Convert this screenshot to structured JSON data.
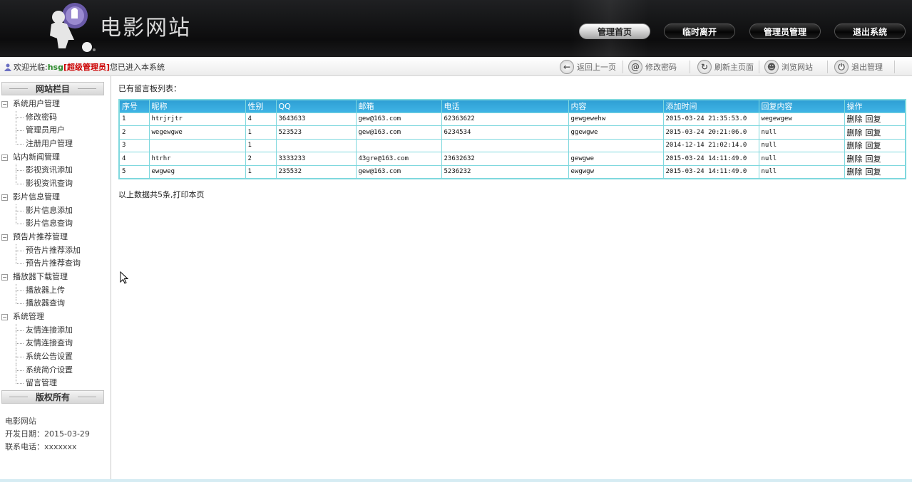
{
  "header": {
    "site_title": "电影网站",
    "nav": [
      {
        "label": "管理首页",
        "active": true
      },
      {
        "label": "临时离开",
        "active": false
      },
      {
        "label": "管理员管理",
        "active": false
      },
      {
        "label": "退出系统",
        "active": false
      }
    ]
  },
  "toolbar": {
    "welcome_prefix": "欢迎光临:",
    "username": "hsg",
    "role": "[超级管理员]",
    "welcome_suffix": "您已进入本系统",
    "buttons": [
      {
        "label": "返回上一页",
        "icon": "back-arrow-icon"
      },
      {
        "label": "修改密码",
        "icon": "swirl-icon"
      },
      {
        "label": "刷新主页面",
        "icon": "refresh-icon"
      },
      {
        "label": "浏览网站",
        "icon": "browse-icon"
      },
      {
        "label": "退出管理",
        "icon": "power-icon"
      }
    ]
  },
  "sidebar": {
    "section_title": "网站栏目",
    "groups": [
      {
        "label": "系统用户管理",
        "items": [
          "修改密码",
          "管理员用户",
          "注册用户管理"
        ]
      },
      {
        "label": "站内新闻管理",
        "items": [
          "影视资讯添加",
          "影视资讯查询"
        ]
      },
      {
        "label": "影片信息管理",
        "items": [
          "影片信息添加",
          "影片信息查询"
        ]
      },
      {
        "label": "预告片推荐管理",
        "items": [
          "预告片推荐添加",
          "预告片推荐查询"
        ]
      },
      {
        "label": "播放器下载管理",
        "items": [
          "播放器上传",
          "播放器查询"
        ]
      },
      {
        "label": "系统管理",
        "items": [
          "友情连接添加",
          "友情连接查询",
          "系统公告设置",
          "系统简介设置",
          "留言管理"
        ]
      }
    ],
    "copyright_title": "版权所有",
    "copyright_lines": [
      "电影网站",
      "开发日期：2015-03-29",
      "联系电话：xxxxxxx"
    ]
  },
  "main": {
    "list_title": "已有留言板列表：",
    "columns": [
      "序号",
      "昵称",
      "性别",
      "QQ",
      "邮箱",
      "电话",
      "内容",
      "添加时间",
      "回复内容",
      "操作"
    ],
    "rows": [
      [
        "1",
        "htrjrjtr",
        "4",
        "3643633",
        "gew@163.com",
        "62363622",
        "gewgewehw",
        "2015-03-24 21:35:53.0",
        "wegewgew"
      ],
      [
        "2",
        "wegewgwe",
        "1",
        "523523",
        "gew@163.com",
        "6234534",
        "ggewgwe",
        "2015-03-24 20:21:06.0",
        "null"
      ],
      [
        "3",
        "",
        "1",
        "",
        "",
        "",
        "",
        "2014-12-14 21:02:14.0",
        "null"
      ],
      [
        "4",
        "htrhr",
        "2",
        "3333233",
        "43gre@163.com",
        "23632632",
        "gewgwe",
        "2015-03-24 14:11:49.0",
        "null"
      ],
      [
        "5",
        "ewgweg",
        "1",
        "235532",
        "gew@163.com",
        "5236232",
        "ewgwgw",
        "2015-03-24 14:11:49.0",
        "null"
      ]
    ],
    "op_delete": "删除",
    "op_reply": "回复",
    "summary_prefix": "以上数据共5条,",
    "print_label": "打印本页"
  }
}
